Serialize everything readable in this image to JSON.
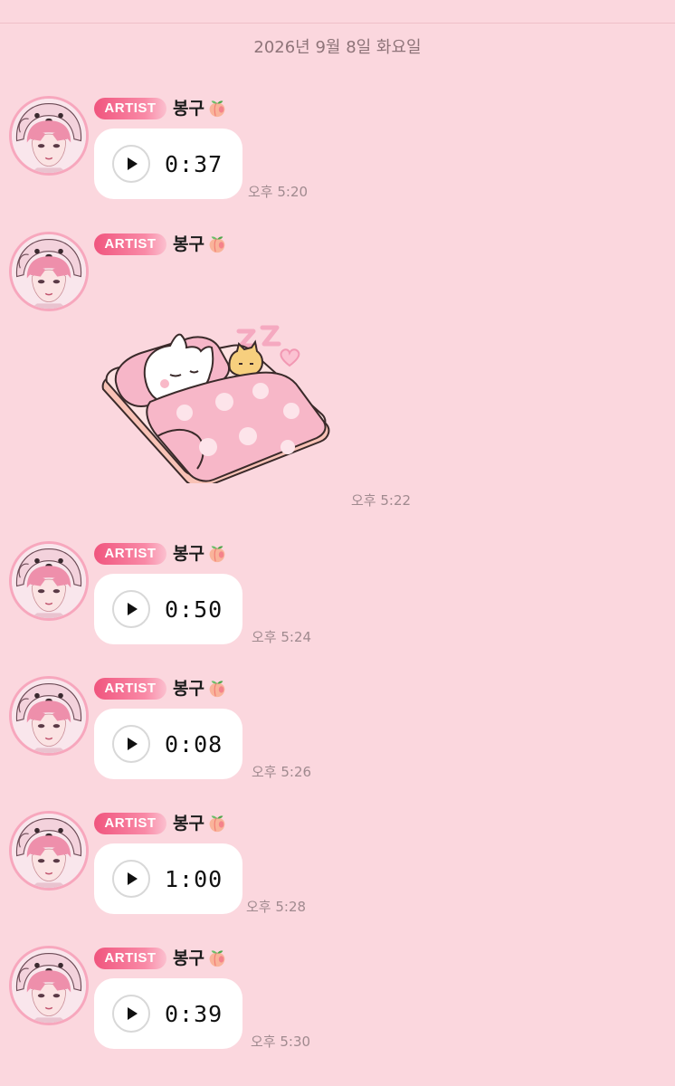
{
  "date_header": "2026년 9월 8일 화요일",
  "messages": [
    {
      "badge": "ARTIST",
      "sender": "봉구",
      "type": "voice",
      "duration": "0:37",
      "time": "오후 5:20"
    },
    {
      "badge": "ARTIST",
      "sender": "봉구",
      "type": "sticker",
      "sticker": "sleeping-cats-sticker",
      "time": "오후 5:22"
    },
    {
      "badge": "ARTIST",
      "sender": "봉구",
      "type": "voice",
      "duration": "0:50",
      "time": "오후 5:24"
    },
    {
      "badge": "ARTIST",
      "sender": "봉구",
      "type": "voice",
      "duration": "0:08",
      "time": "오후 5:26"
    },
    {
      "badge": "ARTIST",
      "sender": "봉구",
      "type": "voice",
      "duration": "1:00",
      "time": "오후 5:28"
    },
    {
      "badge": "ARTIST",
      "sender": "봉구",
      "type": "voice",
      "duration": "0:39",
      "time": "오후 5:30"
    }
  ],
  "colors": {
    "background": "#fbd7de",
    "badge_start": "#f0557e",
    "badge_end": "#fbc0cf",
    "bubble": "#ffffff",
    "timestamp": "#a08a8f"
  },
  "icons": {
    "avatar": "avatar-icon",
    "play": "play-icon",
    "peach": "peach-icon"
  }
}
